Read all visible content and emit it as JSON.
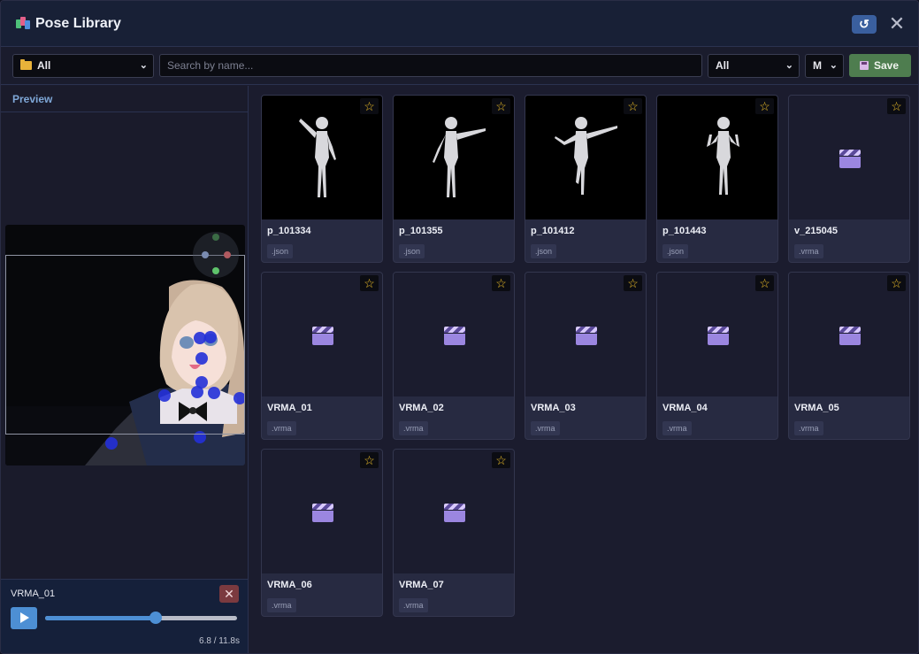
{
  "window": {
    "title": "Pose Library",
    "refresh_label": "↺",
    "close_label": "✕"
  },
  "toolbar": {
    "folder_value": "All",
    "search_placeholder": "Search by name...",
    "search_value": "",
    "filter_value": "All",
    "mode_value": "M",
    "save_label": "Save"
  },
  "preview": {
    "label": "Preview"
  },
  "playback": {
    "name": "VRMA_01",
    "close_label": "✕",
    "time": "6.8 / 11.8s",
    "current_seconds": 6.8,
    "total_seconds": 11.8
  },
  "items": [
    {
      "name": "p_101334",
      "ext": ".json",
      "type": "pose"
    },
    {
      "name": "p_101355",
      "ext": ".json",
      "type": "pose"
    },
    {
      "name": "p_101412",
      "ext": ".json",
      "type": "pose"
    },
    {
      "name": "p_101443",
      "ext": ".json",
      "type": "pose"
    },
    {
      "name": "v_215045",
      "ext": ".vrma",
      "type": "anim"
    },
    {
      "name": "VRMA_01",
      "ext": ".vrma",
      "type": "anim"
    },
    {
      "name": "VRMA_02",
      "ext": ".vrma",
      "type": "anim"
    },
    {
      "name": "VRMA_03",
      "ext": ".vrma",
      "type": "anim"
    },
    {
      "name": "VRMA_04",
      "ext": ".vrma",
      "type": "anim"
    },
    {
      "name": "VRMA_05",
      "ext": ".vrma",
      "type": "anim"
    },
    {
      "name": "VRMA_06",
      "ext": ".vrma",
      "type": "anim"
    },
    {
      "name": "VRMA_07",
      "ext": ".vrma",
      "type": "anim"
    }
  ],
  "icons": {
    "favorite": "star-icon",
    "animation": "clapperboard-icon",
    "folder": "folder-icon",
    "save": "floppy-disk-icon"
  },
  "colors": {
    "accent": "#4d8fd4",
    "save": "#4e7d4f",
    "star": "#f0c02a",
    "danger": "#7b3a3f"
  }
}
